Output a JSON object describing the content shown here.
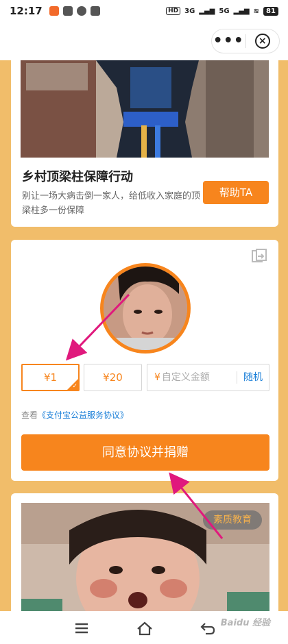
{
  "status_bar": {
    "time": "12:17",
    "network_tags": [
      "HD",
      "3G",
      "5G"
    ],
    "battery": "81"
  },
  "nav": {
    "more_label": "•••",
    "close_label": "×"
  },
  "project_card": {
    "title": "乡村顶梁柱保障行动",
    "description": "别让一场大病击倒一家人，给低收入家庭的顶梁柱多一份保障",
    "help_button": "帮助TA"
  },
  "donation": {
    "amounts": [
      {
        "label": "¥1",
        "selected": true
      },
      {
        "label": "¥20",
        "selected": false
      }
    ],
    "custom_prefix": "¥",
    "custom_placeholder": "自定义金额",
    "random_label": "随机",
    "agreement_prefix": "查看",
    "agreement_link": "《支付宝公益服务协议》",
    "donate_button": "同意协议并捐赠"
  },
  "next_card": {
    "tag": "素质教育"
  },
  "watermark": "Baidu 经验",
  "colors": {
    "background": "#f1bd6a",
    "accent": "#f7851d",
    "link": "#1a7fd8",
    "arrow": "#e0197d"
  }
}
